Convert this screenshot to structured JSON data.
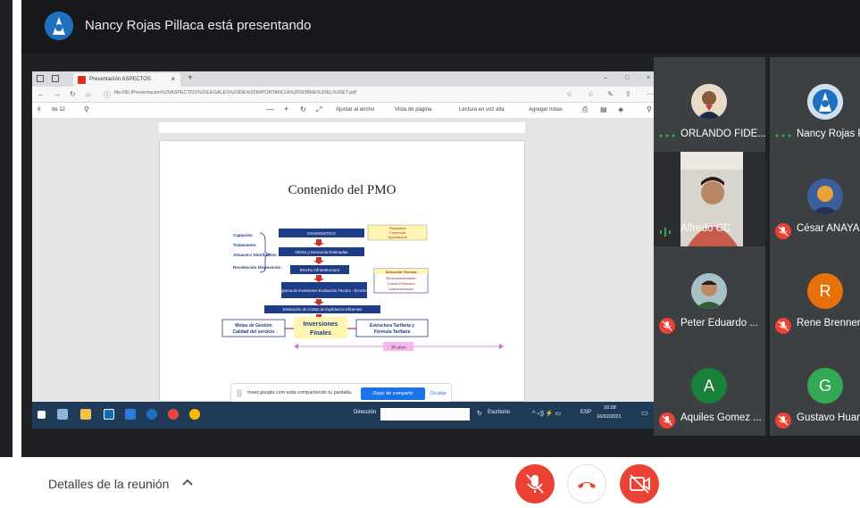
{
  "presenter": {
    "name": "Nancy Rojas Pillaca está presentando"
  },
  "browser": {
    "tab_title": "Presentación ASPECTOS",
    "tab_close": "×",
    "new_tab": "+",
    "url": "file:///E:/Presentacion%20ASPECTOS%20LEGALES%20DE%20IMPORTANCIA%20SOBRE%20EL%20ET.pdf",
    "win_controls": [
      "–",
      "□",
      "×"
    ]
  },
  "pdf_toolbar": {
    "page_current": "6",
    "page_total": "de 12",
    "fit_width": "Ajustar al ancho",
    "page_view": "Vista de página",
    "read_aloud": "Lectura en voz alta",
    "add_notes": "Agregar notas"
  },
  "document": {
    "title": "Contenido del PMO",
    "diagram": {
      "left_items": [
        "Captación",
        "Tratamiento",
        "Almacen./ Distribución",
        "Recolección Disposición"
      ],
      "steps": [
        "DIAGNOSTICO",
        "Oferta y Demanda Estimadas",
        "Brecha Infraestructura",
        "Programa de Inversiones Evaluación Técnico - Económica",
        "Estimación de Costos de Explotación Eficientes"
      ],
      "box_financial": [
        "Financiera",
        "Comercial",
        "Operacional"
      ],
      "box_technical_title": "Selección Técnica",
      "box_technical": [
        "Dimensionamiento",
        "Costos Eficientes",
        "Calendarización"
      ],
      "left_goal": [
        "Metas de Gestión",
        "Calidad del servicio"
      ],
      "center_goal": [
        "Inversiones",
        "Finales"
      ],
      "right_goal": [
        "Estructura Tarifaria y",
        "Fórmula Tarifaria"
      ],
      "years": "30 años"
    }
  },
  "share_notice": {
    "text": "meet.google.com está compartiendo tu pantalla.",
    "stop_button": "Dejar de compartir",
    "hide": "Ocultar"
  },
  "taskbar": {
    "search_label": "Dirección",
    "desktop": "Escritorio",
    "lang": "ESP",
    "time": "10:28",
    "date": "16/02/2021"
  },
  "participants": [
    {
      "name": "ORLANDO FIDE...",
      "status": "speaking-dots",
      "avatar": "photo"
    },
    {
      "name": "Nancy Rojas P",
      "status": "speaking-dots",
      "avatar": "logo"
    },
    {
      "name": "Alfredo CC",
      "status": "speaking",
      "avatar": "video"
    },
    {
      "name": "César ANAYA",
      "status": "muted",
      "avatar": "photo"
    },
    {
      "name": "Peter Eduardo ...",
      "status": "muted",
      "avatar": "photo"
    },
    {
      "name": "Rene Brenner",
      "status": "muted",
      "avatar": "R",
      "color": "#e8710a"
    },
    {
      "name": "Aquiles Gomez ...",
      "status": "muted",
      "avatar": "A",
      "color": "#188038"
    },
    {
      "name": "Gustavo Huar",
      "status": "muted",
      "avatar": "G",
      "color": "#34a853"
    }
  ],
  "footer": {
    "details": "Detalles de la reunión"
  },
  "colors": {
    "meet_bg": "#202124",
    "tile_bg": "#3c4043",
    "red": "#ea4335",
    "accent_blue": "#1a73e8"
  }
}
